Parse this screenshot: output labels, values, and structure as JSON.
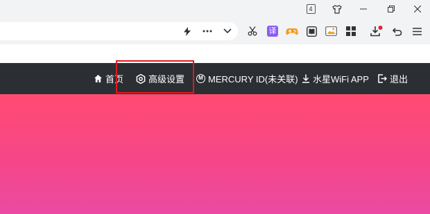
{
  "browser": {
    "tab_count": "4",
    "tab_count_icon": "tab-count-icon",
    "skin_icon": "shirt-icon",
    "window_buttons": [
      "minimize-icon",
      "restore-icon",
      "close-icon"
    ],
    "address_actions": [
      "lightning-icon",
      "more-dots-icon",
      "chevron-down-icon"
    ],
    "toolbar_icons": [
      "scissors-icon",
      "translate-icon",
      "game-icon",
      "reader-icon",
      "screenshot-icon",
      "apps-grid-icon",
      "download-icon",
      "undo-icon",
      "menu-icon"
    ],
    "translate_glyph": "译",
    "download_badge_color": "#e8202a"
  },
  "nav": {
    "background": "#2b2e33",
    "items": [
      {
        "label": "首页",
        "icon": "home-icon"
      },
      {
        "label": "高级设置",
        "icon": "gear-icon"
      },
      {
        "label": "MERCURY ID(未关联)",
        "icon": "mercury-logo-icon",
        "icon_text": "M"
      },
      {
        "label": "水星WiFi APP",
        "icon": "download-arrow-icon"
      },
      {
        "label": "退出",
        "icon": "logout-icon"
      }
    ],
    "highlighted_item": "高级设置",
    "highlight_color": "#e0191e"
  },
  "hero": {
    "gradient_top": "#ff4b72",
    "gradient_bottom": "#ea4aa2"
  }
}
